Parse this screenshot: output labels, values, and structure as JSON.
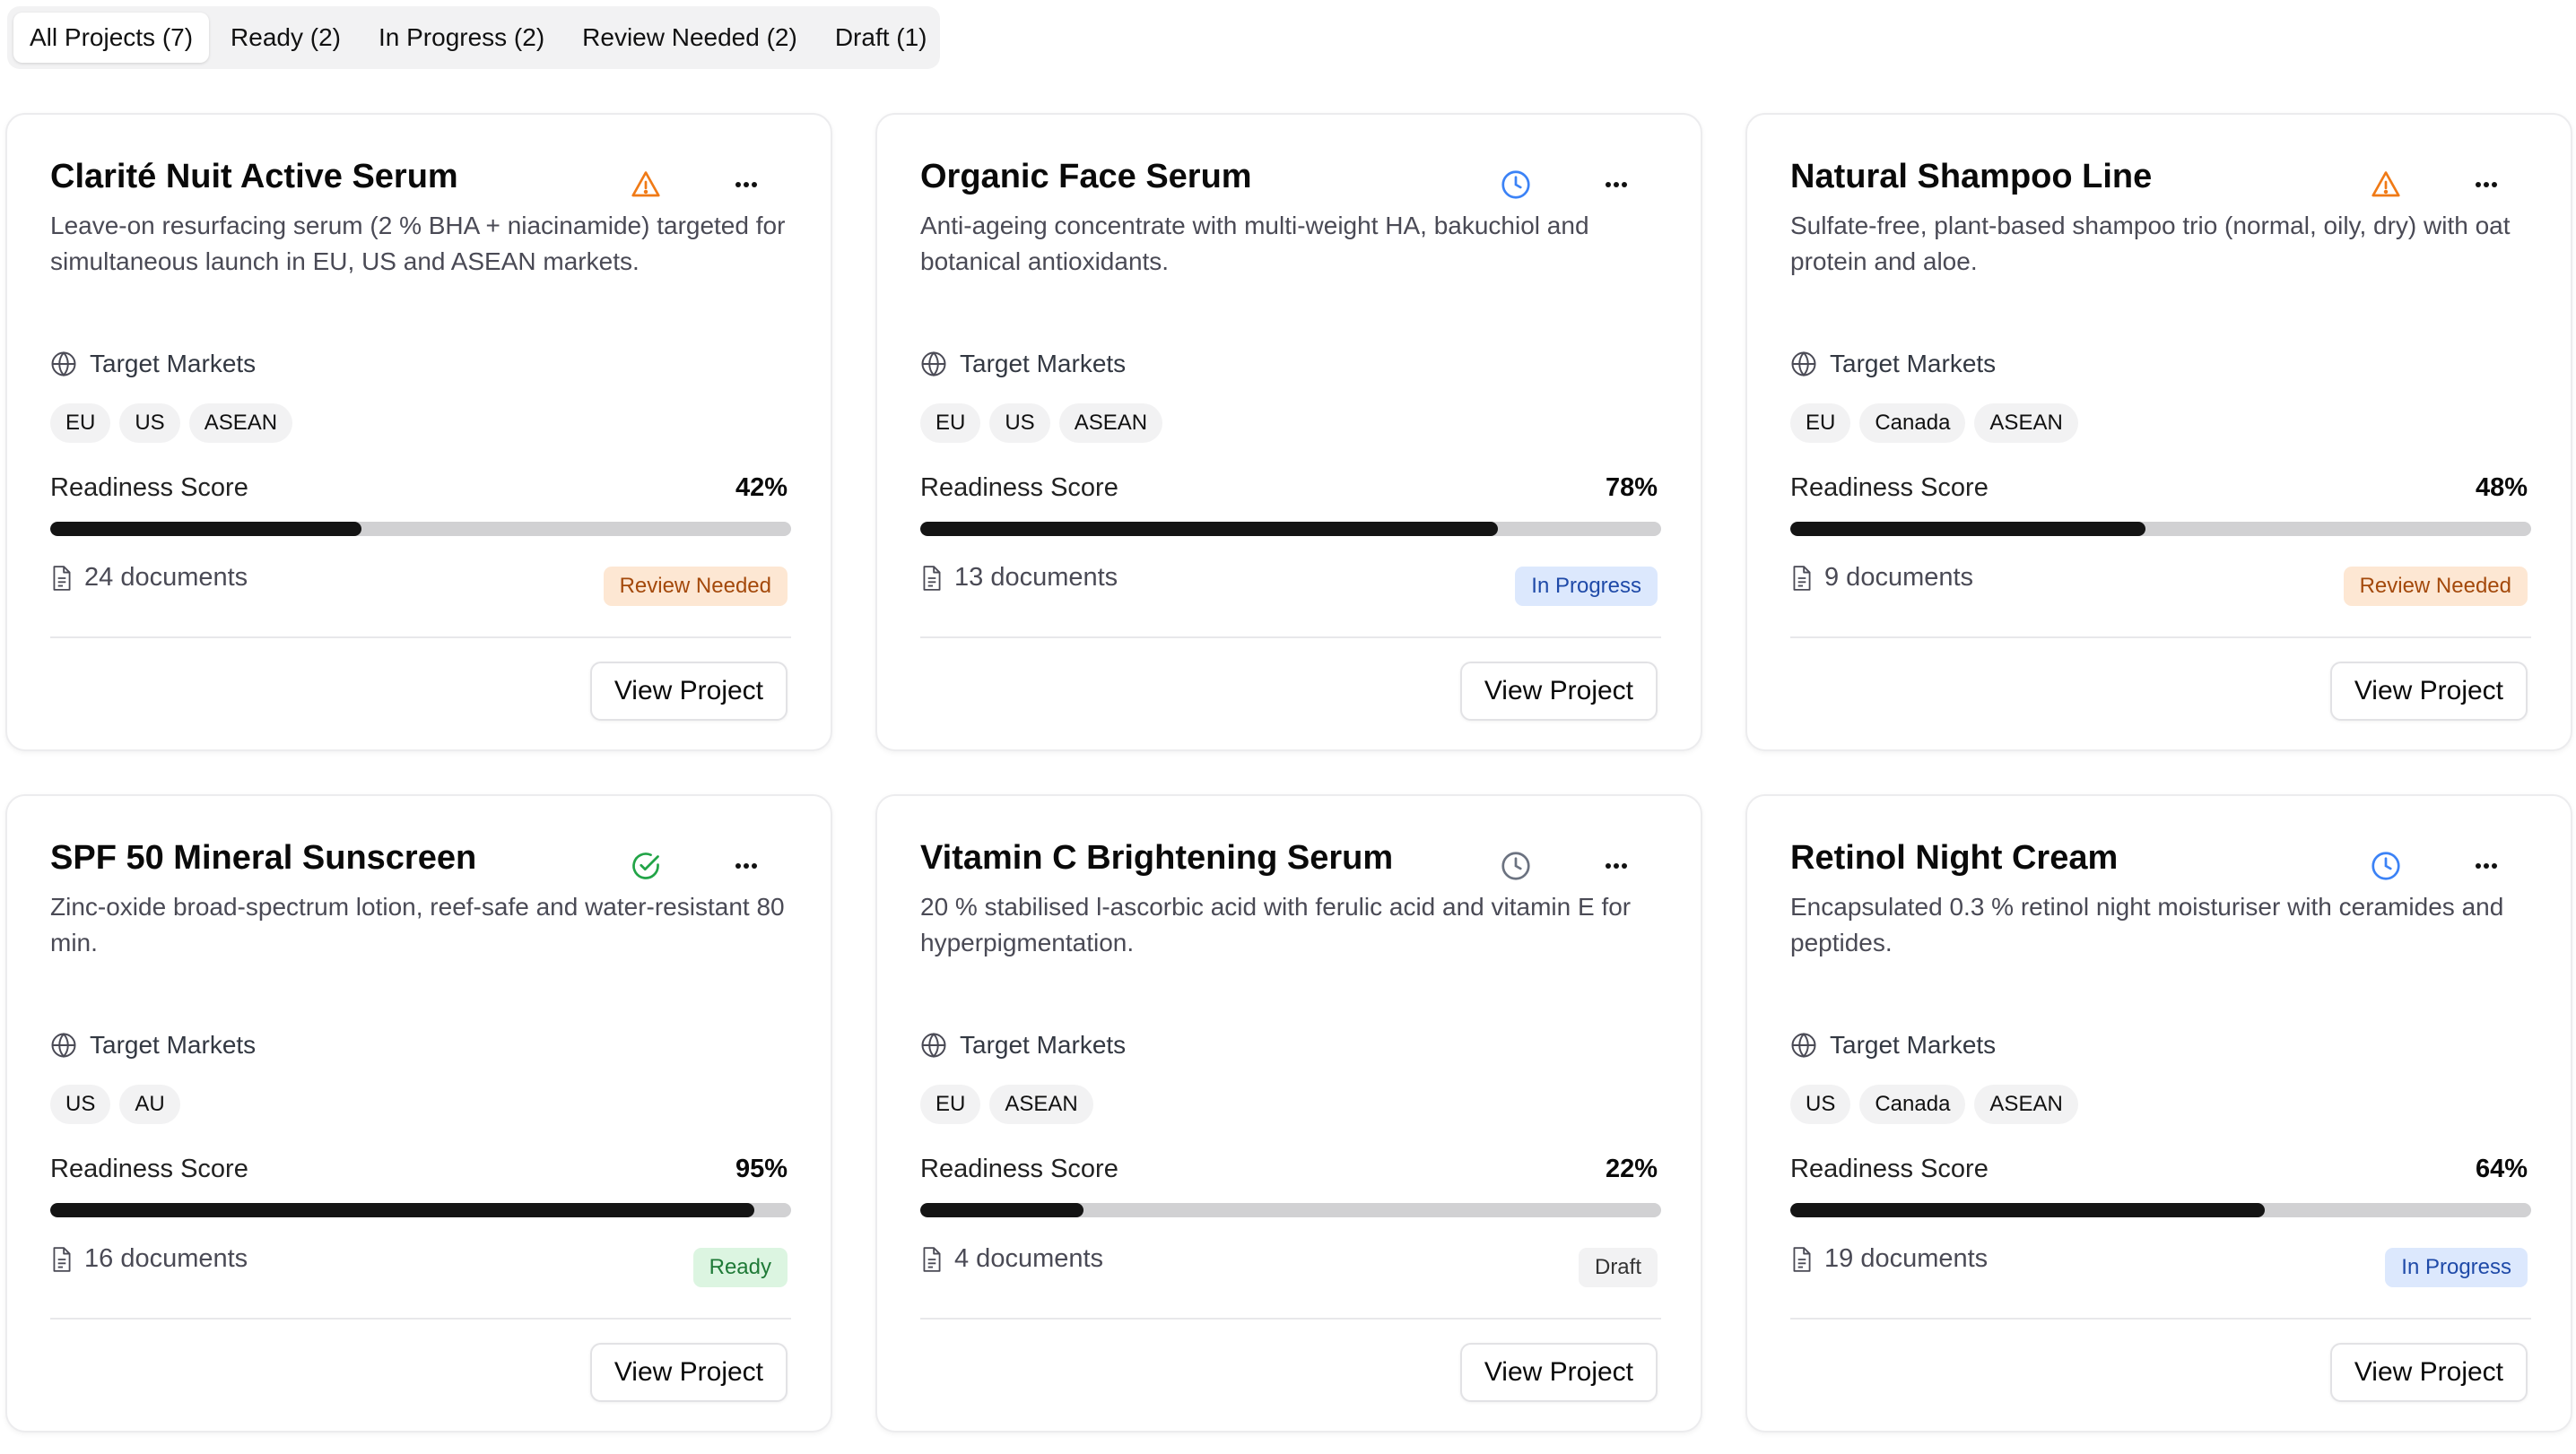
{
  "tabs": [
    {
      "label": "All Projects (7)",
      "active": true
    },
    {
      "label": "Ready (2)",
      "active": false
    },
    {
      "label": "In Progress (2)",
      "active": false
    },
    {
      "label": "Review Needed (2)",
      "active": false
    },
    {
      "label": "Draft (1)",
      "active": false
    }
  ],
  "labels": {
    "markets_heading": "Target Markets",
    "score_label": "Readiness Score",
    "view_button": "View Project"
  },
  "colors": {
    "warning_icon": "#f07a16",
    "clock_in_progress": "#3b82f6",
    "clock_draft": "#6b7280",
    "ready_icon": "#22a447"
  },
  "projects": [
    {
      "title": "Clarité Nuit Active Serum",
      "description": "Leave-on resurfacing serum (2 % BHA + niacinamide) targeted for simultaneous launch in EU, US and ASEAN markets.",
      "status_icon": "warning-icon",
      "markets": [
        "EU",
        "US",
        "ASEAN"
      ],
      "score": 42,
      "score_text": "42%",
      "documents": "24 documents",
      "status": "Review Needed",
      "status_kind": "review"
    },
    {
      "title": "Organic Face Serum",
      "description": "Anti-ageing concentrate with multi-weight HA, bakuchiol and botanical antioxidants.",
      "status_icon": "clock-icon",
      "markets": [
        "EU",
        "US",
        "ASEAN"
      ],
      "score": 78,
      "score_text": "78%",
      "documents": "13 documents",
      "status": "In Progress",
      "status_kind": "progress"
    },
    {
      "title": "Natural Shampoo Line",
      "description": "Sulfate-free, plant-based shampoo trio (normal, oily, dry) with oat protein and aloe.",
      "status_icon": "warning-icon",
      "markets": [
        "EU",
        "Canada",
        "ASEAN"
      ],
      "score": 48,
      "score_text": "48%",
      "documents": "9 documents",
      "status": "Review Needed",
      "status_kind": "review"
    },
    {
      "title": "SPF 50 Mineral Sunscreen",
      "description": "Zinc-oxide broad-spectrum lotion, reef-safe and water-resistant 80 min.",
      "status_icon": "check-circle-icon",
      "markets": [
        "US",
        "AU"
      ],
      "score": 95,
      "score_text": "95%",
      "documents": "16 documents",
      "status": "Ready",
      "status_kind": "ready"
    },
    {
      "title": "Vitamin C Brightening Serum",
      "description": "20 % stabilised l-ascorbic acid with ferulic acid and vitamin E for hyperpigmentation.",
      "status_icon": "clock-icon",
      "markets": [
        "EU",
        "ASEAN"
      ],
      "score": 22,
      "score_text": "22%",
      "documents": "4 documents",
      "status": "Draft",
      "status_kind": "draft"
    },
    {
      "title": "Retinol Night Cream",
      "description": "Encapsulated 0.3 % retinol night moisturiser with ceramides and peptides.",
      "status_icon": "clock-icon",
      "markets": [
        "US",
        "Canada",
        "ASEAN"
      ],
      "score": 64,
      "score_text": "64%",
      "documents": "19 documents",
      "status": "In Progress",
      "status_kind": "progress"
    }
  ]
}
